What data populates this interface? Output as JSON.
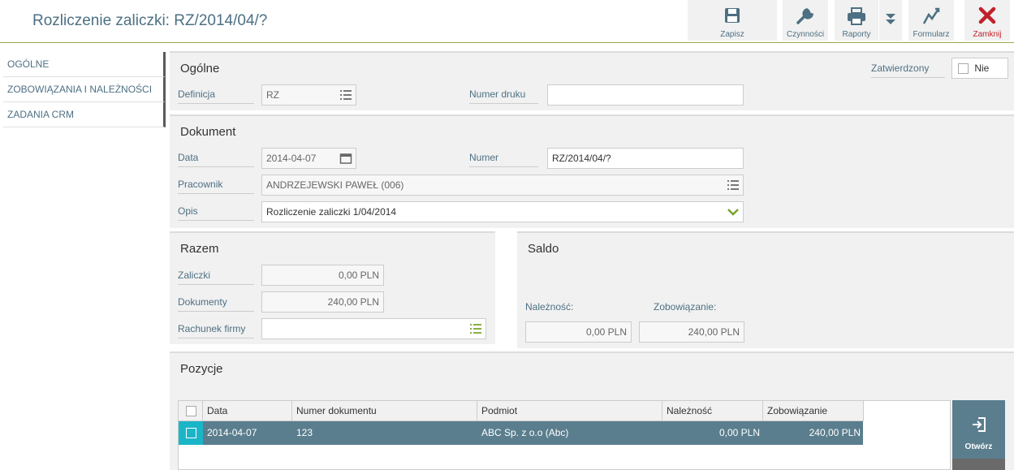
{
  "header": {
    "title": "Rozliczenie zaliczki: RZ/2014/04/?"
  },
  "toolbar": {
    "save": "Zapisz",
    "actions": "Czynności",
    "reports": "Raporty",
    "form": "Formularz",
    "close": "Zamknij"
  },
  "sidebar": {
    "items": [
      {
        "label": "OGÓLNE"
      },
      {
        "label": "ZOBOWIĄZANIA I NALEŻNOŚCI"
      },
      {
        "label": "ZADANIA CRM"
      }
    ]
  },
  "general": {
    "title": "Ogólne",
    "definition_label": "Definicja",
    "definition_value": "RZ",
    "print_number_label": "Numer druku",
    "print_number_value": "",
    "approved_label": "Zatwierdzony",
    "approved_value": "Nie"
  },
  "document": {
    "title": "Dokument",
    "date_label": "Data",
    "date_value": "2014-04-07",
    "number_label": "Numer",
    "number_value": "RZ/2014/04/?",
    "employee_label": "Pracownik",
    "employee_value": "ANDRZEJEWSKI PAWEŁ (006)",
    "desc_label": "Opis",
    "desc_value": "Rozliczenie zaliczki 1/04/2014"
  },
  "totals": {
    "title": "Razem",
    "advances_label": "Zaliczki",
    "advances_value": "0,00 PLN",
    "documents_label": "Dokumenty",
    "documents_value": "240,00 PLN",
    "account_label": "Rachunek firmy",
    "account_value": ""
  },
  "balance": {
    "title": "Saldo",
    "receivable_label": "Należność:",
    "receivable_value": "0,00 PLN",
    "liability_label": "Zobowiązanie:",
    "liability_value": "240,00 PLN"
  },
  "positions": {
    "title": "Pozycje",
    "columns": [
      "Data",
      "Numer dokumentu",
      "Podmiot",
      "Należność",
      "Zobowiązanie"
    ],
    "rows": [
      {
        "date": "2014-04-07",
        "doc_number": "123",
        "entity": "ABC Sp. z o.o (Abc)",
        "receivable": "0,00 PLN",
        "liability": "240,00 PLN"
      }
    ],
    "open_button": "Otwórz"
  },
  "colors": {
    "accent": "#4d7083",
    "selected_row": "#5a7e8e",
    "close_red": "#c0222a",
    "green": "#7aa32b"
  }
}
